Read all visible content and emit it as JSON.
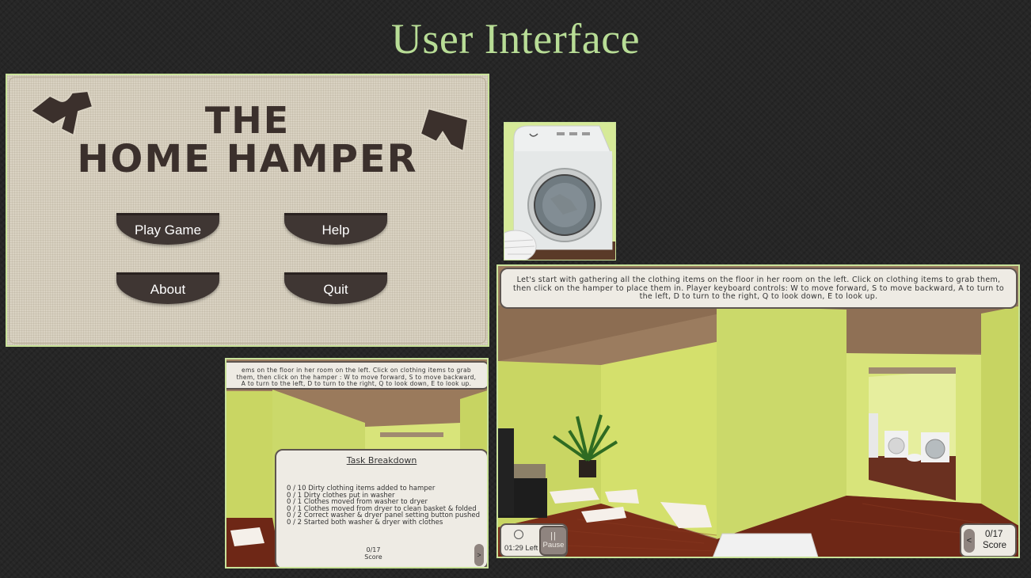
{
  "slide": {
    "title": "User Interface"
  },
  "menu": {
    "title_line1": "THE",
    "title_line2": "HOME HAMPER",
    "buttons": {
      "play": "Play Game",
      "help": "Help",
      "about": "About",
      "quit": "Quit"
    }
  },
  "room": {
    "instructions": "Let's start with gathering all the clothing items on the floor in her room on the left. Click on clothing items to grab them, then click on the hamper to place them in. Player keyboard controls: W to move forward, S to move backward, A to turn to the left, D to turn to the right, Q to look down, E to look up.",
    "timer": "01:29 Left",
    "pause_label": "Pause",
    "pause_icon": "||",
    "score_count": "0/17",
    "score_label": "Score",
    "score_arrow": "<"
  },
  "tasks": {
    "instructions_cropped": "ems on the floor in her room on the left. Click on clothing items to grab them, then click on the hamper : W to move forward, S to move backward, A to turn to the left, D to turn to the right, Q to look down, E to look up.",
    "heading": "Task Breakdown",
    "items": [
      "0 / 10 Dirty clothing items added to hamper",
      "0 / 1 Dirty clothes put in washer",
      "0 / 1 Clothes moved from washer to dryer",
      "0 / 1 Clothes moved from dryer to clean basket & folded",
      "0 / 2 Correct washer & dryer panel setting button pushed",
      "0 / 2 Started both washer & dryer with clothes"
    ],
    "score_count": "0/17",
    "score_label": "Score",
    "next_arrow": ">"
  },
  "colors": {
    "accent_title": "#b8dd96",
    "panel_border": "#c9e29a",
    "wall": "#d8e47a",
    "button_dark": "#3f3633"
  }
}
